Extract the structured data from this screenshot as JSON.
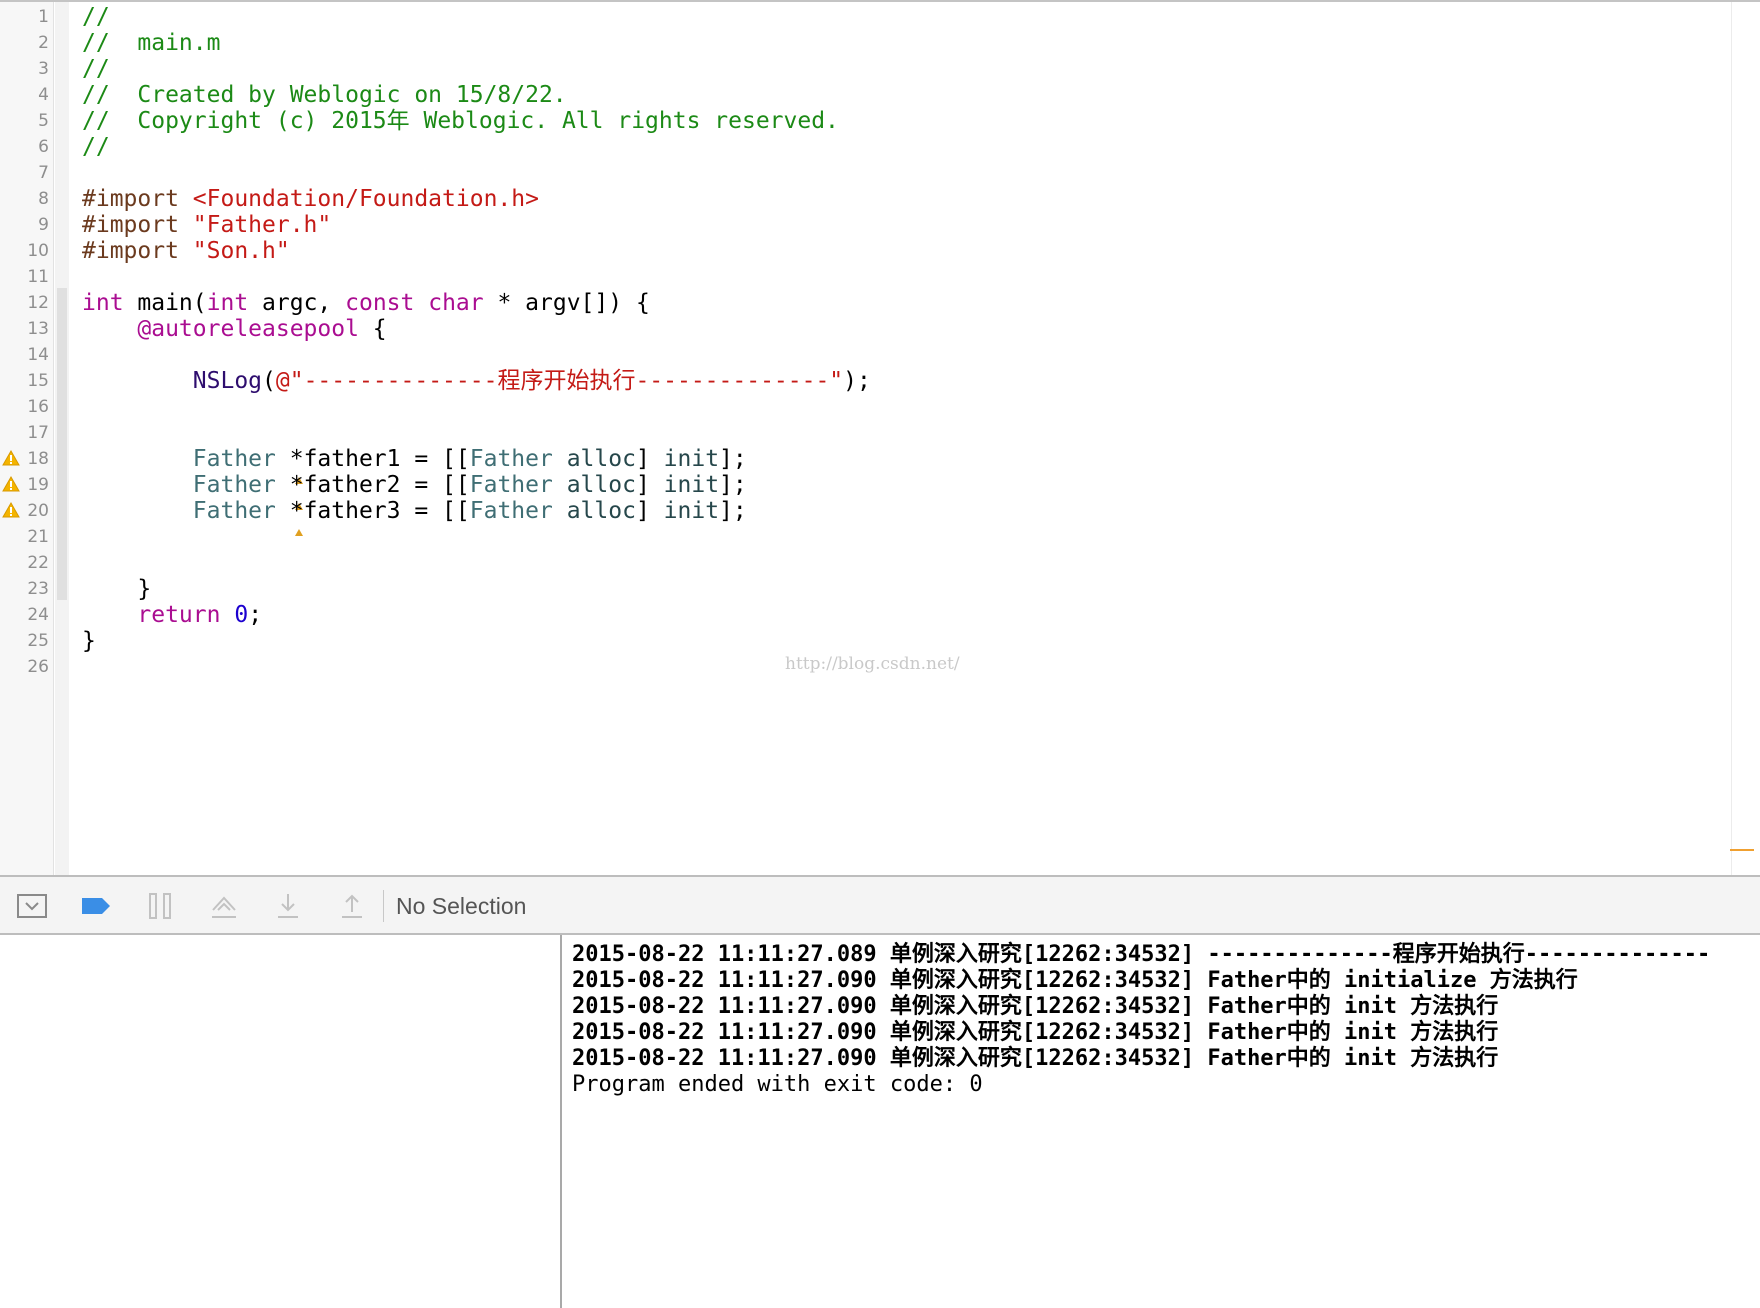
{
  "editor": {
    "lines": [
      {
        "n": "1",
        "warn": false,
        "segs": [
          {
            "c": "c-comment",
            "t": "//"
          }
        ]
      },
      {
        "n": "2",
        "warn": false,
        "segs": [
          {
            "c": "c-comment",
            "t": "//  main.m"
          }
        ]
      },
      {
        "n": "3",
        "warn": false,
        "segs": [
          {
            "c": "c-comment",
            "t": "//"
          }
        ]
      },
      {
        "n": "4",
        "warn": false,
        "segs": [
          {
            "c": "c-comment",
            "t": "//  Created by Weblogic on 15/8/22."
          }
        ]
      },
      {
        "n": "5",
        "warn": false,
        "segs": [
          {
            "c": "c-comment",
            "t": "//  Copyright (c) 2015年 Weblogic. All rights reserved."
          }
        ]
      },
      {
        "n": "6",
        "warn": false,
        "segs": [
          {
            "c": "c-comment",
            "t": "//"
          }
        ]
      },
      {
        "n": "7",
        "warn": false,
        "segs": []
      },
      {
        "n": "8",
        "warn": false,
        "segs": [
          {
            "c": "c-pre",
            "t": "#import "
          },
          {
            "c": "c-inc",
            "t": "<Foundation/Foundation.h>"
          }
        ]
      },
      {
        "n": "9",
        "warn": false,
        "segs": [
          {
            "c": "c-pre",
            "t": "#import "
          },
          {
            "c": "c-inc",
            "t": "\"Father.h\""
          }
        ]
      },
      {
        "n": "10",
        "warn": false,
        "segs": [
          {
            "c": "c-pre",
            "t": "#import "
          },
          {
            "c": "c-inc",
            "t": "\"Son.h\""
          }
        ]
      },
      {
        "n": "11",
        "warn": false,
        "segs": []
      },
      {
        "n": "12",
        "warn": false,
        "segs": [
          {
            "c": "c-kw",
            "t": "int"
          },
          {
            "c": "",
            "t": " main("
          },
          {
            "c": "c-kw",
            "t": "int"
          },
          {
            "c": "",
            "t": " argc, "
          },
          {
            "c": "c-kw",
            "t": "const"
          },
          {
            "c": "",
            "t": " "
          },
          {
            "c": "c-kw",
            "t": "char"
          },
          {
            "c": "",
            "t": " * argv[]) {"
          }
        ]
      },
      {
        "n": "13",
        "warn": false,
        "segs": [
          {
            "c": "",
            "t": "    "
          },
          {
            "c": "c-kw",
            "t": "@autoreleasepool"
          },
          {
            "c": "",
            "t": " {"
          }
        ]
      },
      {
        "n": "14",
        "warn": false,
        "segs": []
      },
      {
        "n": "15",
        "warn": false,
        "segs": [
          {
            "c": "",
            "t": "        "
          },
          {
            "c": "c-nslog",
            "t": "NSLog"
          },
          {
            "c": "",
            "t": "("
          },
          {
            "c": "c-str",
            "t": "@\"--------------程序开始执行--------------\""
          },
          {
            "c": "",
            "t": ");"
          }
        ]
      },
      {
        "n": "16",
        "warn": false,
        "segs": []
      },
      {
        "n": "17",
        "warn": false,
        "segs": []
      },
      {
        "n": "18",
        "warn": true,
        "segs": [
          {
            "c": "",
            "t": "        "
          },
          {
            "c": "c-type",
            "t": "Father"
          },
          {
            "c": "",
            "t": " *father1 = [["
          },
          {
            "c": "c-type",
            "t": "Father"
          },
          {
            "c": "",
            "t": " "
          },
          {
            "c": "c-msg",
            "t": "alloc"
          },
          {
            "c": "",
            "t": "] "
          },
          {
            "c": "c-msg",
            "t": "init"
          },
          {
            "c": "",
            "t": "];"
          }
        ]
      },
      {
        "n": "19",
        "warn": true,
        "segs": [
          {
            "c": "",
            "t": "        "
          },
          {
            "c": "c-type",
            "t": "Father"
          },
          {
            "c": "",
            "t": " *father2 = [["
          },
          {
            "c": "c-type",
            "t": "Father"
          },
          {
            "c": "",
            "t": " "
          },
          {
            "c": "c-msg",
            "t": "alloc"
          },
          {
            "c": "",
            "t": "] "
          },
          {
            "c": "c-msg",
            "t": "init"
          },
          {
            "c": "",
            "t": "];"
          }
        ]
      },
      {
        "n": "20",
        "warn": true,
        "segs": [
          {
            "c": "",
            "t": "        "
          },
          {
            "c": "c-type",
            "t": "Father"
          },
          {
            "c": "",
            "t": " *father3 = [["
          },
          {
            "c": "c-type",
            "t": "Father"
          },
          {
            "c": "",
            "t": " "
          },
          {
            "c": "c-msg",
            "t": "alloc"
          },
          {
            "c": "",
            "t": "] "
          },
          {
            "c": "c-msg",
            "t": "init"
          },
          {
            "c": "",
            "t": "];"
          }
        ]
      },
      {
        "n": "21",
        "warn": false,
        "segs": []
      },
      {
        "n": "22",
        "warn": false,
        "segs": []
      },
      {
        "n": "23",
        "warn": false,
        "segs": [
          {
            "c": "",
            "t": "    }"
          }
        ]
      },
      {
        "n": "24",
        "warn": false,
        "segs": [
          {
            "c": "",
            "t": "    "
          },
          {
            "c": "c-kw",
            "t": "return"
          },
          {
            "c": "",
            "t": " "
          },
          {
            "c": "c-num",
            "t": "0"
          },
          {
            "c": "",
            "t": ";"
          }
        ]
      },
      {
        "n": "25",
        "warn": false,
        "segs": [
          {
            "c": "",
            "t": "}"
          }
        ]
      },
      {
        "n": "26",
        "warn": false,
        "segs": []
      }
    ],
    "watermark": "http://blog.csdn.net/"
  },
  "debugbar": {
    "buttons": [
      {
        "name": "hide-debug-area-button",
        "icon": "hide-debug-area-icon"
      },
      {
        "name": "breakpoints-toggle-button",
        "icon": "breakpoint-icon"
      },
      {
        "name": "pause-button",
        "icon": "pause-icon"
      },
      {
        "name": "step-over-button",
        "icon": "step-over-icon"
      },
      {
        "name": "step-into-button",
        "icon": "step-into-icon"
      },
      {
        "name": "step-out-button",
        "icon": "step-out-icon"
      }
    ],
    "selection_label": "No Selection"
  },
  "console": {
    "lines": [
      {
        "prefix": "2015-08-22 11:11:27.089 单例深入研究[12262:34532] ",
        "msg": "--------------程序开始执行--------------"
      },
      {
        "prefix": "2015-08-22 11:11:27.090 单例深入研究[12262:34532] ",
        "msg": "Father中的 initialize 方法执行"
      },
      {
        "prefix": "2015-08-22 11:11:27.090 单例深入研究[12262:34532] ",
        "msg": "Father中的 init 方法执行"
      },
      {
        "prefix": "2015-08-22 11:11:27.090 单例深入研究[12262:34532] ",
        "msg": "Father中的 init 方法执行"
      },
      {
        "prefix": "2015-08-22 11:11:27.090 单例深入研究[12262:34532] ",
        "msg": "Father中的 init 方法执行"
      }
    ],
    "exit_line": "Program ended with exit code: 0"
  },
  "colors": {
    "comment": "#1c8a16",
    "preprocessor": "#6b3a1e",
    "string": "#c41a16",
    "keyword": "#aa0d91",
    "type": "#3f6e74",
    "number": "#1c00cf",
    "warning": "#f4b400",
    "breakpoint_blue": "#3a8ee6"
  }
}
